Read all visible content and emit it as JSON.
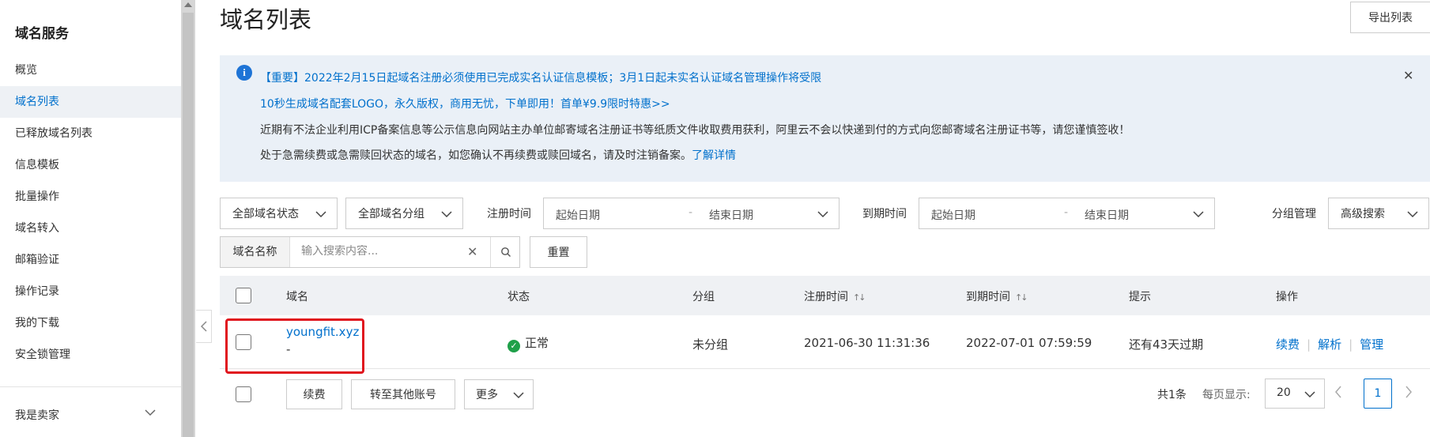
{
  "sidebar": {
    "title": "域名服务",
    "items": [
      {
        "label": "概览"
      },
      {
        "label": "域名列表",
        "active": true
      },
      {
        "label": "已释放域名列表"
      },
      {
        "label": "信息模板"
      },
      {
        "label": "批量操作"
      },
      {
        "label": "域名转入"
      },
      {
        "label": "邮箱验证"
      },
      {
        "label": "操作记录"
      },
      {
        "label": "我的下载"
      },
      {
        "label": "安全锁管理"
      }
    ],
    "seller": "我是卖家"
  },
  "header": {
    "title": "域名列表",
    "export_label": "导出列表"
  },
  "notice": {
    "line1": "【重要】2022年2月15日起域名注册必须使用已完成实名认证信息模板；3月1日起未实名认证域名管理操作将受限",
    "line2": "10秒生成域名配套LOGO，永久版权，商用无忧，下单即用！首单¥9.9限时特惠>>",
    "line3": "近期有不法企业利用ICP备案信息等公示信息向网站主办单位邮寄域名注册证书等纸质文件收取费用获利，阿里云不会以快递到付的方式向您邮寄域名注册证书等，请您谨慎签收！",
    "line4_text": "处于急需续费或急需赎回状态的域名，如您确认不再续费或赎回域名，请及时注销备案。",
    "line4_link": "了解详情"
  },
  "filters": {
    "status": "全部域名状态",
    "group": "全部域名分组",
    "reg_label": "注册时间",
    "reg_start": "起始日期",
    "reg_end": "结束日期",
    "exp_label": "到期时间",
    "exp_start": "起始日期",
    "exp_end": "结束日期",
    "group_manage": "分组管理",
    "advanced": "高级搜索",
    "range_sep": "-"
  },
  "search": {
    "field_label": "域名名称",
    "placeholder": "输入搜索内容...",
    "reset_label": "重置"
  },
  "table": {
    "columns": [
      "域名",
      "状态",
      "分组",
      "注册时间",
      "到期时间",
      "提示",
      "操作"
    ],
    "rows": [
      {
        "domain": "youngfit.xyz",
        "sub": "-",
        "status": "正常",
        "group": "未分组",
        "reg_time": "2021-06-30 11:31:36",
        "exp_time": "2022-07-01 07:59:59",
        "hint": "还有43天过期",
        "ops": [
          "续费",
          "解析",
          "管理"
        ]
      }
    ]
  },
  "footer": {
    "renew_label": "续费",
    "transfer_label": "转至其他账号",
    "more_label": "更多",
    "total": "共1条",
    "page_size_label": "每页显示:",
    "page_size": "20",
    "current_page": "1"
  },
  "colors": {
    "accent": "#0070cc",
    "highlight": "#e0141e",
    "ok": "#1fa049"
  }
}
